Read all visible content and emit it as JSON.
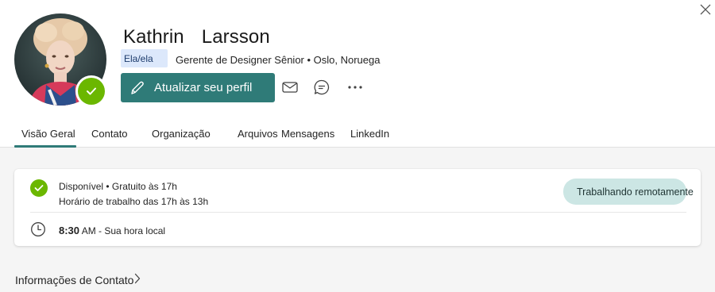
{
  "profile": {
    "first_name": "Kathrin",
    "last_name": "Larsson",
    "pronouns": "Ela/ela",
    "title_location": "Gerente de Designer Sênior • Oslo, Noruega",
    "presence_color": "#6bb700"
  },
  "actions": {
    "update_profile_label": "Atualizar seu perfil",
    "accent_color": "#2f7b78",
    "icons": [
      "pencil-icon",
      "mail-icon",
      "chat-icon",
      "more-icon",
      "close-icon"
    ]
  },
  "tabs": [
    {
      "label": "Visão Geral",
      "selected": true
    },
    {
      "label": "Contato",
      "selected": false
    },
    {
      "label": "Organização",
      "selected": false
    },
    {
      "label": "Arquivos",
      "selected": false
    },
    {
      "label": "Mensagens",
      "selected": false
    },
    {
      "label": "LinkedIn",
      "selected": false
    }
  ],
  "status_card": {
    "availability": "Disponível • Gratuito às 17h",
    "working_hours": "Horário de trabalho das 17h às 13h",
    "local_time": "8:30",
    "local_time_suffix": " AM - Sua hora local",
    "remote_label": "Trabalhando remotamente"
  },
  "sections": {
    "contact_info": "Informações de Contato"
  }
}
